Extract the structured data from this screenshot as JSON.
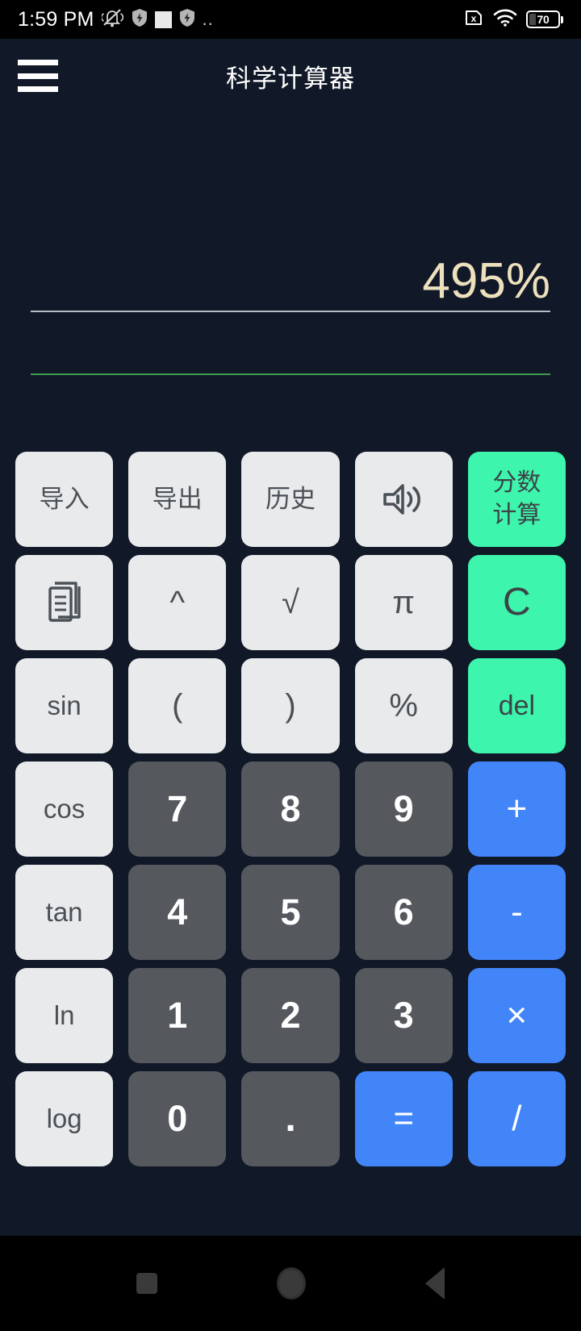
{
  "status_bar": {
    "time": "1:59 PM",
    "left_icons": [
      {
        "name": "bell-muted-icon",
        "glyph": "bell-muted"
      },
      {
        "name": "shield-bolt-icon",
        "glyph": "shield-bolt"
      },
      {
        "name": "white-square-icon",
        "glyph": "square"
      },
      {
        "name": "shield-bolt-icon-2",
        "glyph": "shield-bolt"
      },
      {
        "name": "more-dots-icon",
        "glyph": ".."
      }
    ],
    "more_dots": "..",
    "right_icons": [
      {
        "name": "no-sim-icon",
        "glyph": "x-sim"
      },
      {
        "name": "wifi-icon",
        "glyph": "wifi"
      }
    ],
    "battery_level": "70"
  },
  "app_bar": {
    "menu_icon": "hamburger-menu-icon",
    "title": "科学计算器"
  },
  "display": {
    "expression": "495%",
    "result": "",
    "expression_color": "#ede0bc",
    "expression_underline_color": "#b7bcc4",
    "result_underline_color": "#3f9c4f"
  },
  "theme": {
    "background": "#111827",
    "function_key_bg": "#e9eaec",
    "function_key_fg": "#4a5156",
    "number_key_bg": "#55595d",
    "number_key_fg": "#ffffff",
    "accent_green": "#3df5ad",
    "accent_blue": "#4285f8"
  },
  "keypad": {
    "rows": [
      [
        {
          "label": "导入",
          "kind": "light",
          "style": "cjk",
          "name": "key-import"
        },
        {
          "label": "导出",
          "kind": "light",
          "style": "cjk",
          "name": "key-export"
        },
        {
          "label": "历史",
          "kind": "light",
          "style": "cjk",
          "name": "key-history"
        },
        {
          "label": "",
          "kind": "light",
          "style": "icon",
          "icon": "speaker-volume-icon",
          "name": "key-sound"
        },
        {
          "label": "分数\n计算",
          "kind": "green",
          "style": "cjk",
          "name": "key-fraction-calc"
        }
      ],
      [
        {
          "label": "",
          "kind": "light",
          "style": "icon",
          "icon": "copy-document-icon",
          "name": "key-copy"
        },
        {
          "label": "^",
          "kind": "light",
          "style": "sym",
          "name": "key-power"
        },
        {
          "label": "√",
          "kind": "light",
          "style": "sym",
          "name": "key-sqrt"
        },
        {
          "label": "π",
          "kind": "light",
          "style": "sym",
          "name": "key-pi"
        },
        {
          "label": "C",
          "kind": "green",
          "style": "big",
          "name": "key-clear"
        }
      ],
      [
        {
          "label": "sin",
          "kind": "light",
          "style": "",
          "name": "key-sin"
        },
        {
          "label": "(",
          "kind": "light",
          "style": "sym",
          "name": "key-paren-open"
        },
        {
          "label": ")",
          "kind": "light",
          "style": "sym",
          "name": "key-paren-close"
        },
        {
          "label": "%",
          "kind": "light",
          "style": "sym",
          "name": "key-percent"
        },
        {
          "label": "del",
          "kind": "green",
          "style": "",
          "name": "key-delete"
        }
      ],
      [
        {
          "label": "cos",
          "kind": "light",
          "style": "",
          "name": "key-cos"
        },
        {
          "label": "7",
          "kind": "num",
          "style": "",
          "name": "key-7"
        },
        {
          "label": "8",
          "kind": "num",
          "style": "",
          "name": "key-8"
        },
        {
          "label": "9",
          "kind": "num",
          "style": "",
          "name": "key-9"
        },
        {
          "label": "+",
          "kind": "blue",
          "style": "",
          "name": "key-plus"
        }
      ],
      [
        {
          "label": "tan",
          "kind": "light",
          "style": "",
          "name": "key-tan"
        },
        {
          "label": "4",
          "kind": "num",
          "style": "",
          "name": "key-4"
        },
        {
          "label": "5",
          "kind": "num",
          "style": "",
          "name": "key-5"
        },
        {
          "label": "6",
          "kind": "num",
          "style": "",
          "name": "key-6"
        },
        {
          "label": "-",
          "kind": "blue",
          "style": "",
          "name": "key-minus"
        }
      ],
      [
        {
          "label": "ln",
          "kind": "light",
          "style": "",
          "name": "key-ln"
        },
        {
          "label": "1",
          "kind": "num",
          "style": "",
          "name": "key-1"
        },
        {
          "label": "2",
          "kind": "num",
          "style": "",
          "name": "key-2"
        },
        {
          "label": "3",
          "kind": "num",
          "style": "",
          "name": "key-3"
        },
        {
          "label": "×",
          "kind": "blue",
          "style": "",
          "name": "key-multiply"
        }
      ],
      [
        {
          "label": "log",
          "kind": "light",
          "style": "",
          "name": "key-log"
        },
        {
          "label": "0",
          "kind": "num",
          "style": "",
          "name": "key-0"
        },
        {
          "label": ".",
          "kind": "num",
          "style": "dot",
          "name": "key-decimal"
        },
        {
          "label": "=",
          "kind": "blue",
          "style": "",
          "name": "key-equals"
        },
        {
          "label": "/",
          "kind": "blue",
          "style": "",
          "name": "key-divide"
        }
      ]
    ]
  },
  "nav_bar": {
    "recents": "recents-square-icon",
    "home": "home-circle-icon",
    "back": "back-triangle-icon"
  }
}
